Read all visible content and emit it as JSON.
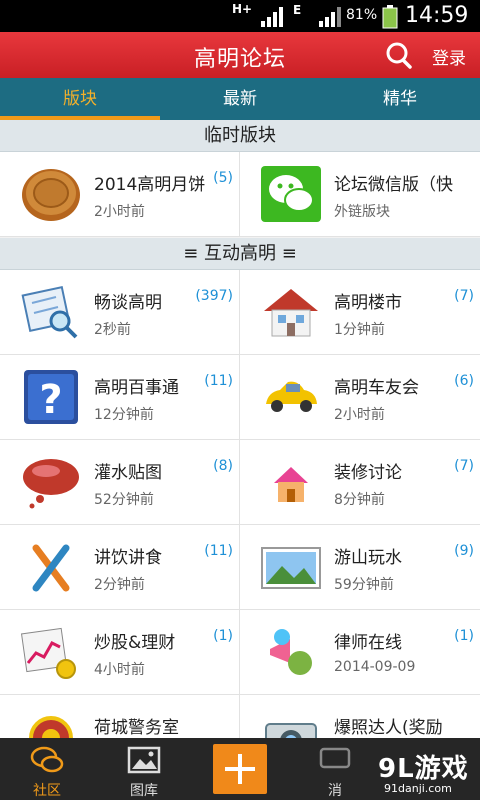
{
  "status_bar": {
    "network": "H+",
    "network2": "E",
    "battery": "81%",
    "time": "14:59"
  },
  "header": {
    "title": "高明论坛",
    "login_label": "登录",
    "search_icon": "search-icon"
  },
  "tabs": [
    {
      "label": "版块",
      "active": true
    },
    {
      "label": "最新",
      "active": false
    },
    {
      "label": "精华",
      "active": false
    }
  ],
  "sections": {
    "temporary": {
      "title": "临时版块",
      "items": [
        {
          "name": "2014高明月饼",
          "count": "(5)",
          "time": "2小时前",
          "icon": "mooncake-icon"
        },
        {
          "name": "论坛微信版（快",
          "count": "",
          "time": "外链版块",
          "icon": "wechat-icon"
        }
      ]
    },
    "interactive": {
      "title": "≡ 互动高明 ≡",
      "items": [
        {
          "name": "畅谈高明",
          "count": "(397)",
          "time": "2秒前",
          "icon": "map-magnifier-icon"
        },
        {
          "name": "高明楼市",
          "count": "(7)",
          "time": "1分钟前",
          "icon": "house-icon"
        },
        {
          "name": "高明百事通",
          "count": "(11)",
          "time": "12分钟前",
          "icon": "question-icon"
        },
        {
          "name": "高明车友会",
          "count": "(6)",
          "time": "2小时前",
          "icon": "car-icon"
        },
        {
          "name": "灌水贴图",
          "count": "(8)",
          "time": "52分钟前",
          "icon": "speech-bubble-icon"
        },
        {
          "name": "装修讨论",
          "count": "(7)",
          "time": "8分钟前",
          "icon": "pink-house-icon"
        },
        {
          "name": "讲饮讲食",
          "count": "(11)",
          "time": "2分钟前",
          "icon": "utensils-icon"
        },
        {
          "name": "游山玩水",
          "count": "(9)",
          "time": "59分钟前",
          "icon": "landscape-icon"
        },
        {
          "name": "炒股&理财",
          "count": "(1)",
          "time": "4小时前",
          "icon": "stock-chart-icon"
        },
        {
          "name": "律师在线",
          "count": "(1)",
          "time": "2014-09-09",
          "icon": "megaphone-icon"
        },
        {
          "name": "荷城警务室",
          "count": "",
          "time": "",
          "icon": "police-badge-icon"
        },
        {
          "name": "爆照达人(奖励",
          "count": "",
          "time": "",
          "icon": "camera-icon"
        }
      ]
    }
  },
  "bottom_nav": {
    "community": "社区",
    "gallery": "图库",
    "messages": "消",
    "watermark_big": "9L游戏",
    "watermark_small": "91danji.com"
  }
}
